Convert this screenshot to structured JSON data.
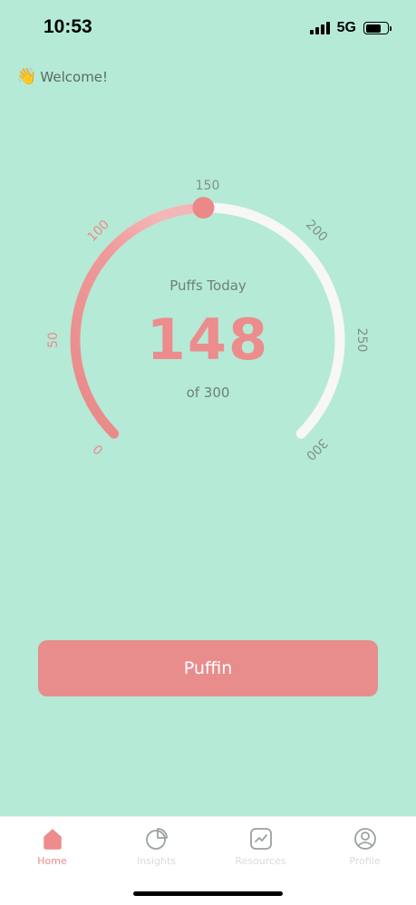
{
  "status": {
    "time": "10:53",
    "network": "5G"
  },
  "welcome": {
    "emoji": "👋",
    "text": "Welcome!"
  },
  "gauge": {
    "label": "Puffs Today",
    "value": "148",
    "max_text": "of 300",
    "current": 148,
    "max": 300,
    "ticks": [
      "0",
      "50",
      "100",
      "150",
      "200",
      "250",
      "300"
    ]
  },
  "action": {
    "button_label": "Puffin"
  },
  "tabs": [
    {
      "label": "Home",
      "icon": "home-icon",
      "active": true
    },
    {
      "label": "Insights",
      "icon": "pie-chart-icon",
      "active": false
    },
    {
      "label": "Resources",
      "icon": "trend-chart-icon",
      "active": false
    },
    {
      "label": "Profile",
      "icon": "profile-icon",
      "active": false
    }
  ],
  "colors": {
    "background": "#B5EAD7",
    "accent": "#E98C8C",
    "track": "#F7F7F5"
  }
}
